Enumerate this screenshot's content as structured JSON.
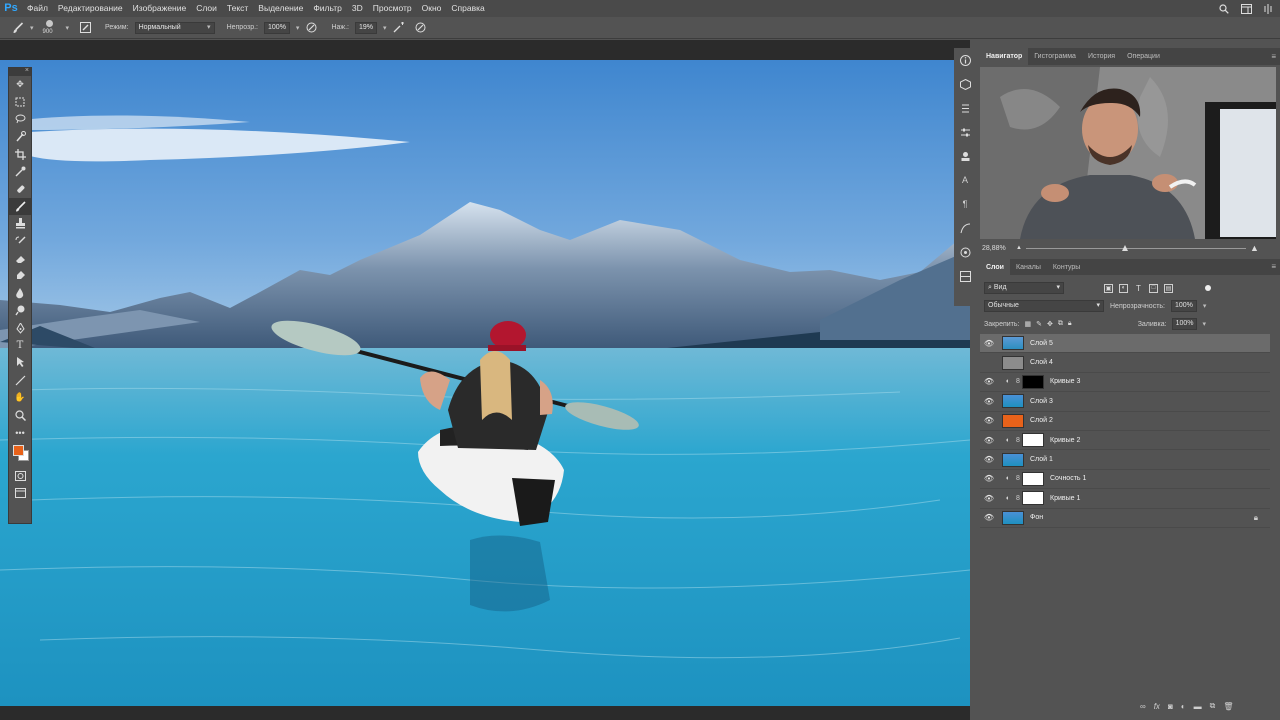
{
  "app": {
    "logo": "Ps"
  },
  "menubar": {
    "items": [
      "Файл",
      "Редактирование",
      "Изображение",
      "Слои",
      "Текст",
      "Выделение",
      "Фильтр",
      "3D",
      "Просмотр",
      "Окно",
      "Справка"
    ],
    "right_icons": [
      "search-icon",
      "workspace-icon",
      "window-icon"
    ]
  },
  "optionsbar": {
    "brush_size": "900",
    "mode_label": "Режим:",
    "mode_value": "Нормальный",
    "opacity_label": "Непрозр.:",
    "opacity_value": "100%",
    "flow_label": "Наж.:",
    "flow_value": "19%"
  },
  "tools": {
    "items": [
      "move-tool",
      "marquee-tool",
      "lasso-tool",
      "quick-select-tool",
      "crop-tool",
      "eyedropper-tool",
      "healing-tool",
      "brush-tool",
      "stamp-tool",
      "history-brush-tool",
      "eraser-tool",
      "gradient-tool",
      "blur-tool",
      "dodge-tool",
      "pen-tool",
      "text-tool",
      "path-select-tool",
      "line-tool",
      "hand-tool",
      "zoom-tool",
      "more-tools"
    ],
    "active": "brush-tool",
    "foreground_color": "#e8621a",
    "background_color": "#ffffff"
  },
  "iconcol": [
    "info-icon",
    "3d-icon",
    "properties-icon",
    "adjustments-icon",
    "libraries-icon",
    "character-icon",
    "paragraph-icon",
    "path-icon",
    "brush-settings-icon",
    "layer-comps-icon"
  ],
  "navigator": {
    "tabs": [
      "Навигатор",
      "Гистограмма",
      "История",
      "Операции"
    ],
    "active_tab": "Навигатор",
    "zoom": "28,88%",
    "zoom_fraction": 0.45
  },
  "layers_panel": {
    "tabs": [
      "Слои",
      "Каналы",
      "Контуры"
    ],
    "active_tab": "Слои",
    "filter_value": "Вид",
    "blend_mode": "Обычные",
    "opacity_label": "Непрозрачность:",
    "opacity_value": "100%",
    "lock_label": "Закрепить:",
    "fill_label": "Заливка:",
    "fill_value": "100%",
    "layers": [
      {
        "name": "Слой 5",
        "type": "image",
        "thumb_color": "#5a9ac8",
        "selected": true
      },
      {
        "name": "Слой 4",
        "type": "image",
        "thumb_color": "#8c8c8c",
        "selected": false
      },
      {
        "name": "Кривые 3",
        "type": "adjustment",
        "mask_color": "#000000",
        "selected": false
      },
      {
        "name": "Слой 3",
        "type": "image",
        "thumb_color": "#4a8ec4",
        "selected": false
      },
      {
        "name": "Слой 2",
        "type": "image",
        "thumb_color": "#e8621a",
        "selected": false
      },
      {
        "name": "Кривые 2",
        "type": "adjustment",
        "mask_color": "#ffffff",
        "selected": false
      },
      {
        "name": "Слой 1",
        "type": "image",
        "thumb_color": "#4a8ec4",
        "selected": false
      },
      {
        "name": "Сочность 1",
        "type": "adjustment",
        "mask_color": "#ffffff",
        "selected": false
      },
      {
        "name": "Кривые 1",
        "type": "adjustment",
        "mask_color": "#ffffff",
        "selected": false
      },
      {
        "name": "Фон",
        "type": "background",
        "thumb_color": "#4a8ec4",
        "selected": false,
        "locked": true
      }
    ],
    "bottom_icons": [
      "link-icon",
      "fx-icon",
      "mask-icon",
      "adjustment-icon",
      "group-icon",
      "new-layer-icon",
      "trash-icon"
    ]
  }
}
